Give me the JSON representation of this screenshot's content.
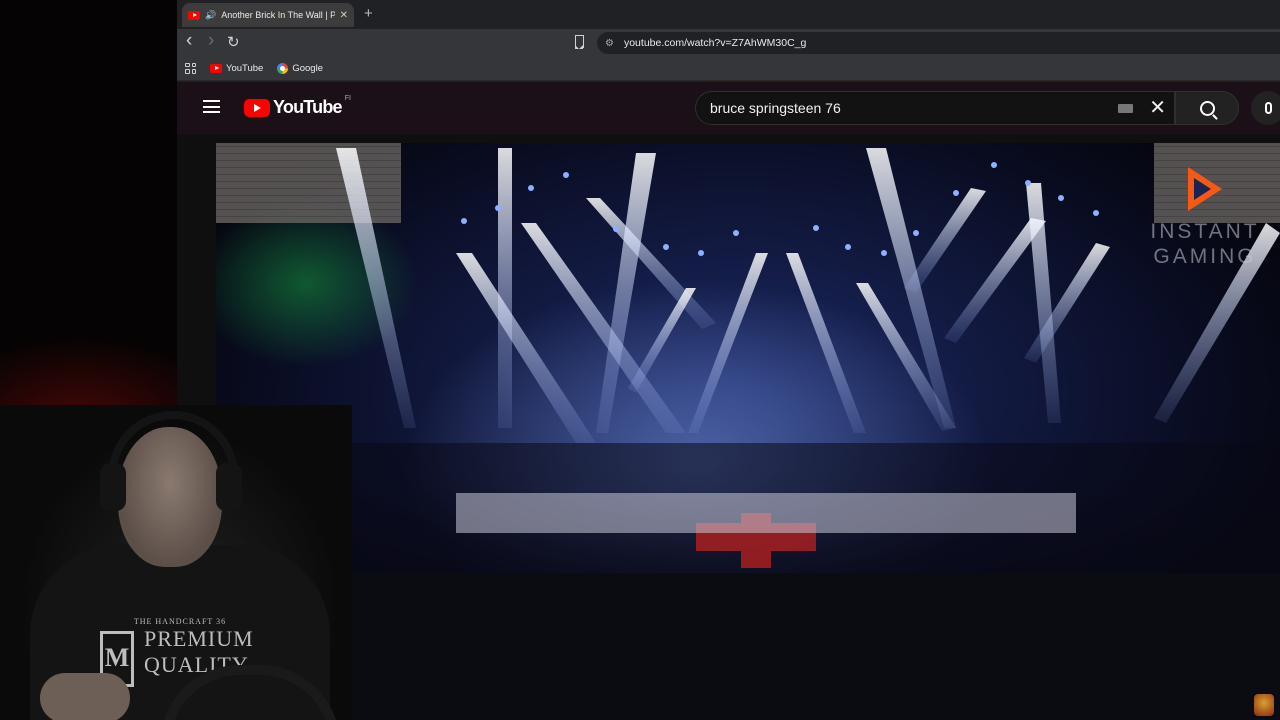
{
  "browser": {
    "tab": {
      "title": "Another Brick In The Wall | P",
      "audio_icon": "speaker-icon",
      "close_label": "✕"
    },
    "new_tab_label": "+",
    "nav": {
      "back": "‹",
      "forward": "›",
      "reload": "↻"
    },
    "address": "youtube.com/watch?v=Z7AhWM30C_g",
    "bookmarks": [
      {
        "label": "YouTube",
        "icon": "youtube-favicon"
      },
      {
        "label": "Google",
        "icon": "google-favicon"
      }
    ]
  },
  "youtube": {
    "logo_text": "YouTube",
    "country_code": "FI",
    "search": {
      "query": "bruce springsteen 76",
      "clear_label": "✕"
    }
  },
  "video": {
    "overlay_brand_line1": "INSTANT",
    "overlay_brand_line2": "GAMING"
  },
  "webcam": {
    "shirt_small": "THE HANDCRAFT 36",
    "shirt_mono": "M",
    "shirt_line1": "PREMIUM",
    "shirt_line2": "QUALITY"
  },
  "colors": {
    "yt_red": "#ff0000",
    "brand_orange": "#ff5a12",
    "stage_blue": "#1c2a66"
  }
}
